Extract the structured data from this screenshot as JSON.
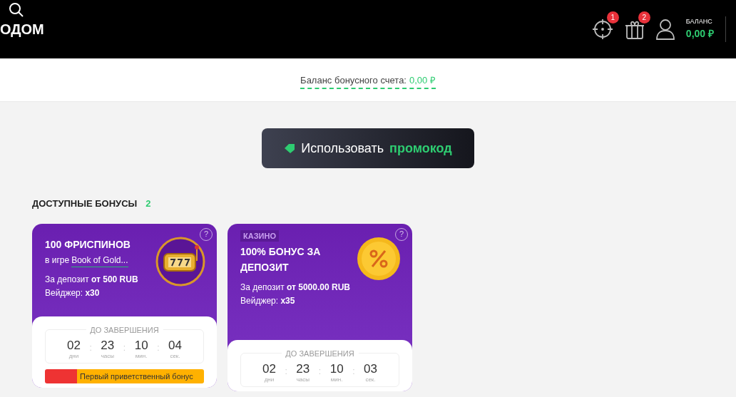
{
  "header": {
    "logo": "ОДОМ",
    "notifications": [
      {
        "kind": "target",
        "count": "1"
      },
      {
        "kind": "gift",
        "count": "2"
      }
    ],
    "balance_label": "БАЛАНС",
    "balance_value": "0,00 ₽"
  },
  "bonus_balance": {
    "label": "Баланс бонусного счета:",
    "value": "0,00 ₽"
  },
  "promo_button": {
    "text": "Использовать",
    "highlight": "промокод"
  },
  "available_bonuses": {
    "title": "ДОСТУПНЫЕ БОНУСЫ",
    "count": "2"
  },
  "cards": [
    {
      "kind": "slots",
      "help": "?",
      "title": "100 ФРИСПИНОВ",
      "game_prefix": "в игре",
      "game_link": "Book of Gold...",
      "deposit": "За депозит **от 500 RUB**",
      "wager": "Вейджер: **x30**",
      "timer_title": "ДО ЗАВЕРШЕНИЯ",
      "separator": ":",
      "timer": [
        {
          "value": "02",
          "unit": "дни"
        },
        {
          "value": "23",
          "unit": "часы"
        },
        {
          "value": "10",
          "unit": "мин."
        },
        {
          "value": "04",
          "unit": "сек."
        }
      ],
      "ribbon": "Первый приветственный бонус"
    },
    {
      "kind": "coin",
      "help": "?",
      "tag": "КАЗИНО",
      "title": "100% БОНУС ЗА ДЕПОЗИТ",
      "deposit": "За депозит **от 5000.00 RUB**",
      "wager": "Вейджер: **x35**",
      "timer_title": "ДО ЗАВЕРШЕНИЯ",
      "separator": ":",
      "timer": [
        {
          "value": "02",
          "unit": "дни"
        },
        {
          "value": "23",
          "unit": "часы"
        },
        {
          "value": "10",
          "unit": "мин."
        },
        {
          "value": "03",
          "unit": "сек."
        }
      ]
    }
  ]
}
